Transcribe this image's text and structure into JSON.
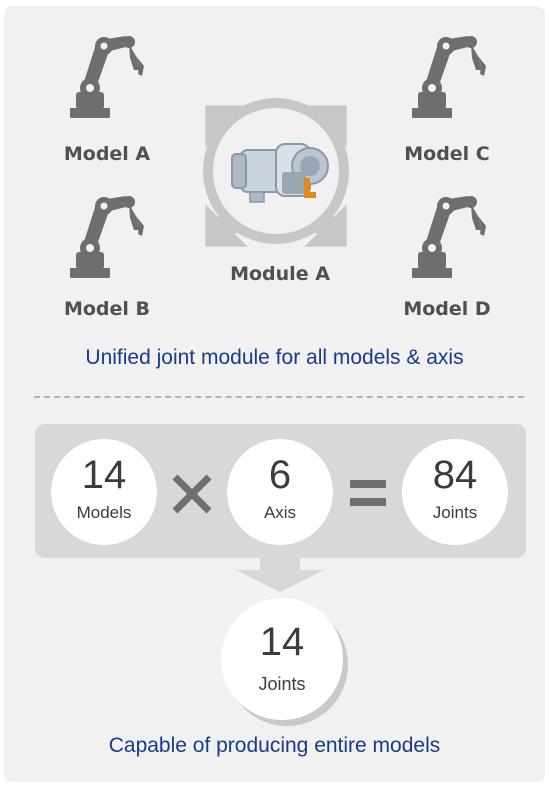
{
  "top_section": {
    "models": [
      {
        "label": "Model A"
      },
      {
        "label": "Model B"
      },
      {
        "label": "Model C"
      },
      {
        "label": "Model D"
      }
    ],
    "center_module_label": "Module A",
    "tagline": "Unified joint module for all models & axis"
  },
  "formula": {
    "operand1": {
      "number": "14",
      "unit": "Models"
    },
    "operator1": "multiply-icon",
    "operand2": {
      "number": "6",
      "unit": "Axis"
    },
    "operator2": "equals-icon",
    "result": {
      "number": "84",
      "unit": "Joints"
    }
  },
  "result_section": {
    "number": "14",
    "unit": "Joints",
    "caption": "Capable of producing entire models"
  },
  "colors": {
    "panel_background": "#f1f1f1",
    "formula_box": "#d8d8d8",
    "robot_gray": "#6e6e6e",
    "arrow_gray": "#c7c7c7",
    "module_accent": "#e08a1e",
    "tagline_blue": "#1a3a8a"
  }
}
